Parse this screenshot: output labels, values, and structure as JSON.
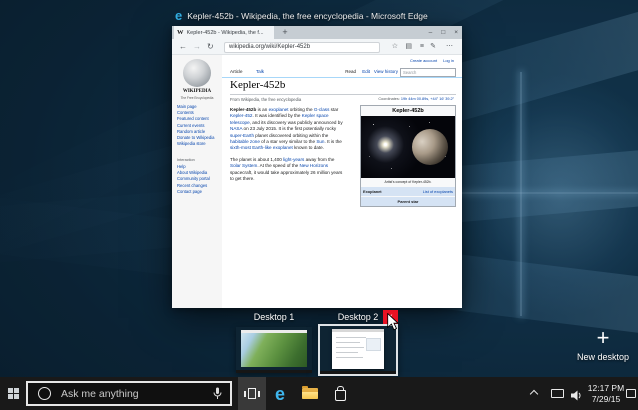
{
  "colors": {
    "accent_blue": "#0078d7",
    "close_red": "#e81123",
    "wiki_link": "#0645ad",
    "edge_blue": "#3fb6ed",
    "taskbar_bg": "#191919"
  },
  "window": {
    "title": "Kepler-452b - Wikipedia, the free encyclopedia - Microsoft Edge",
    "edge_glyph": "e",
    "tab_title": "Kepler-452b - Wikipedia, the f...",
    "tab_favicon": "W",
    "new_tab": "+",
    "minimize": "–",
    "maximize": "□",
    "close": "×",
    "back": "←",
    "forward": "→",
    "refresh": "↻",
    "url": "wikipedia.org/wiki/Kepler-452b",
    "star": "☆",
    "reading": "▤",
    "hub": "≡",
    "note": "✎",
    "more": "⋯"
  },
  "wiki": {
    "wordmark": "WIKIPEDIA",
    "tagline": "The Free Encyclopedia",
    "nav": [
      "Main page",
      "Contents",
      "Featured content",
      "Current events",
      "Random article",
      "Donate to Wikipedia",
      "Wikipedia store"
    ],
    "interaction_title": "Interaction",
    "interaction": [
      "Help",
      "About Wikipedia",
      "Community portal",
      "Recent changes",
      "Contact page"
    ],
    "create_account": "Create account",
    "log_in": "Log in",
    "tab_article": "Article",
    "tab_talk": "Talk",
    "read": "Read",
    "edit": "Edit",
    "view_history": "View history",
    "search_placeholder": "Search",
    "title": "Kepler-452b",
    "byline": "From Wikipedia, the free encyclopedia",
    "coords_label": "Coordinates:",
    "coords_value": "19h 44m 00.89s, +44° 16′ 39.2″",
    "p1": [
      {
        "t": "Kepler-452b",
        "s": "b"
      },
      {
        "t": " is an "
      },
      {
        "t": "exoplanet",
        "s": "l"
      },
      {
        "t": " orbiting the "
      },
      {
        "t": "G-class",
        "s": "l"
      },
      {
        "t": " star "
      },
      {
        "t": "Kepler-452",
        "s": "l"
      },
      {
        "t": ". It was identified by the "
      },
      {
        "t": "Kepler space telescope",
        "s": "l"
      },
      {
        "t": ", and its discovery was publicly announced by "
      },
      {
        "t": "NASA",
        "s": "l"
      },
      {
        "t": " on 23 July 2015. It is the first potentially rocky "
      },
      {
        "t": "super-Earth",
        "s": "l"
      },
      {
        "t": " planet discovered orbiting within the "
      },
      {
        "t": "habitable zone",
        "s": "l"
      },
      {
        "t": " of a star very similar to the "
      },
      {
        "t": "Sun",
        "s": "l"
      },
      {
        "t": ". It is the "
      },
      {
        "t": "sixth-most Earth-like exoplanet",
        "s": "l"
      },
      {
        "t": " known to date."
      }
    ],
    "p2": [
      {
        "t": "The planet is about 1,400 "
      },
      {
        "t": "light-years",
        "s": "l"
      },
      {
        "t": " away from the "
      },
      {
        "t": "Solar System",
        "s": "l"
      },
      {
        "t": ". At the speed of the "
      },
      {
        "t": "New Horizons",
        "s": "l"
      },
      {
        "t": " spacecraft, it would take approximately 26 million years to get there."
      }
    ],
    "infobox": {
      "title": "Kepler-452b",
      "caption": "Artist's concept of Kepler-452b.",
      "type": "Exoplanet",
      "type_link": "List of exoplanets",
      "section": "Parent star"
    }
  },
  "taskview": {
    "desktop1": "Desktop 1",
    "desktop2": "Desktop 2",
    "close": "×",
    "plus": "+",
    "new_desktop": "New desktop"
  },
  "taskbar": {
    "search_placeholder": "Ask me anything",
    "time": "12:17 PM",
    "date": "7/29/15"
  }
}
